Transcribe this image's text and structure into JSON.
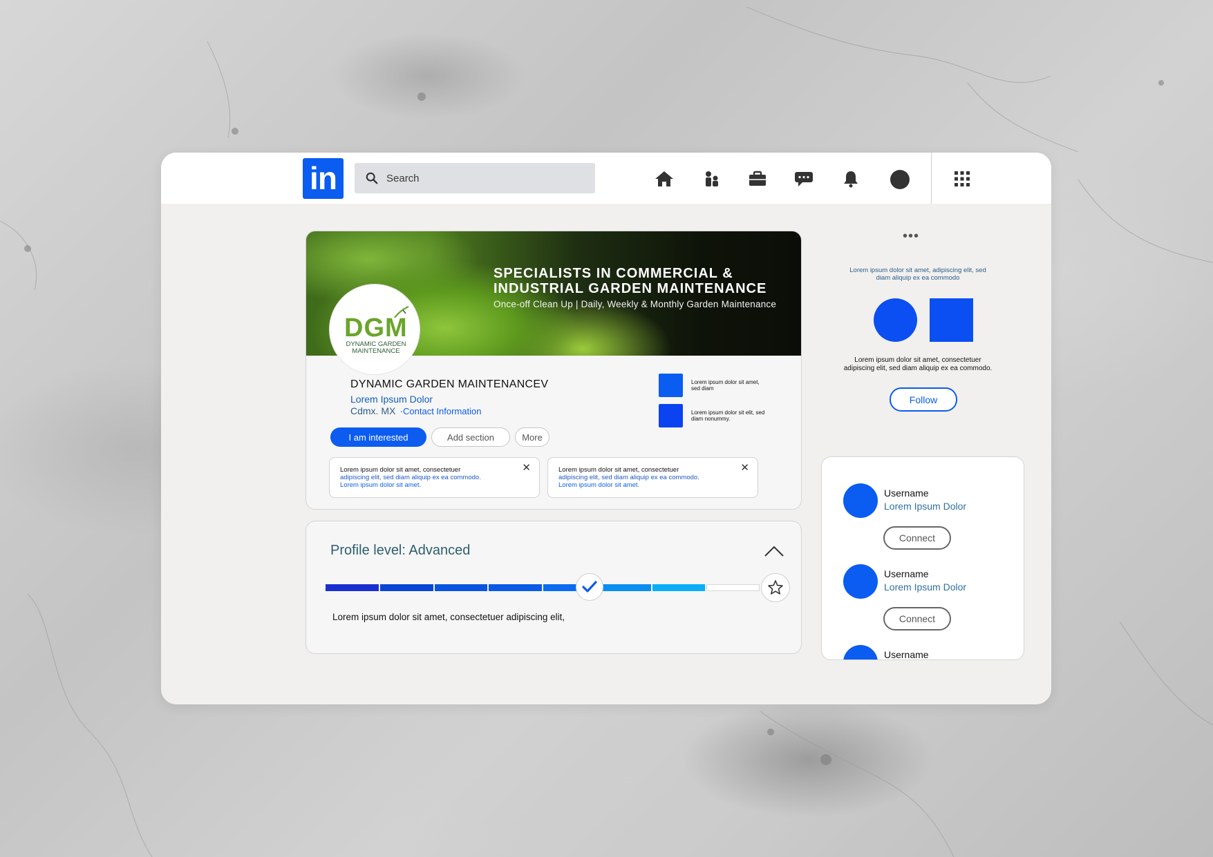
{
  "brand": {
    "logo_text": "in",
    "color": "#0b5cf0"
  },
  "search": {
    "placeholder": "Search"
  },
  "nav": {
    "icons": [
      "home-icon",
      "people-icon",
      "briefcase-icon",
      "messages-icon",
      "bell-icon",
      "avatar",
      "apps-grid-icon"
    ]
  },
  "banner": {
    "title_line1": "SPECIALISTS IN COMMERCIAL &",
    "title_line2": "INDUSTRIAL GARDEN MAINTENANCE",
    "subtitle": "Once-off Clean Up | Daily, Weekly & Monthly Garden Maintenance"
  },
  "company_logo": {
    "letters": "DGM",
    "line1": "DYNAMIC GARDEN",
    "line2": "MAINTENANCE"
  },
  "company": {
    "name": "DYNAMIC GARDEN MAINTENANCEV",
    "tagline": "Lorem Ipsum Dolor",
    "location": "Cdmx. MX",
    "contact_link": "Contact Information"
  },
  "stats": [
    {
      "text": "Lorem ipsum dolor sit amet, sed diam",
      "color": "#0b5cf0"
    },
    {
      "text": "Lorem ipsum dolor sit elit, sed diam nonummy.",
      "color": "#0b43f0"
    }
  ],
  "actions": {
    "primary": "I am interested",
    "add_section": "Add section",
    "more": "More"
  },
  "notices": [
    {
      "line1": "Lorem ipsum dolor sit amet, consectetuer",
      "line2": "adipiscing elit, sed diam aliquip ex ea commodo.",
      "line3": "Lorem ipsum dolor sit amet.",
      "close": "✕"
    },
    {
      "line1": "Lorem ipsum dolor sit amet, consectetuer",
      "line2": "adipiscing elit, sed diam aliquip ex ea commodo.",
      "line3": "Lorem ipsum dolor sit amet.",
      "close": "✕"
    }
  ],
  "profile_level": {
    "title": "Profile level: Advanced",
    "description": "Lorem ipsum dolor sit amet, consectetuer adipiscing elit,",
    "segment_colors": [
      "#1a2fcf",
      "#0a46d6",
      "#0a55e0",
      "#0a5ae6",
      "#0a6cf0",
      "#0a8ef2",
      "#0aaef7"
    ],
    "completed_segments": 7,
    "total_segments": 8
  },
  "aside": {
    "more": "•••",
    "text1": "Lorem ipsum dolor sit amet, adipiscing elit, sed diam aliquip ex ea commodo",
    "text2": "Lorem ipsum dolor sit amet, consectetuer adipiscing elit, sed diam aliquip ex ea commodo.",
    "follow": "Follow"
  },
  "people": [
    {
      "name": "Username",
      "title": "Lorem Ipsum Dolor",
      "action": "Connect"
    },
    {
      "name": "Username",
      "title": "Lorem Ipsum Dolor",
      "action": "Connect"
    },
    {
      "name": "Username",
      "title": "",
      "action": ""
    }
  ]
}
